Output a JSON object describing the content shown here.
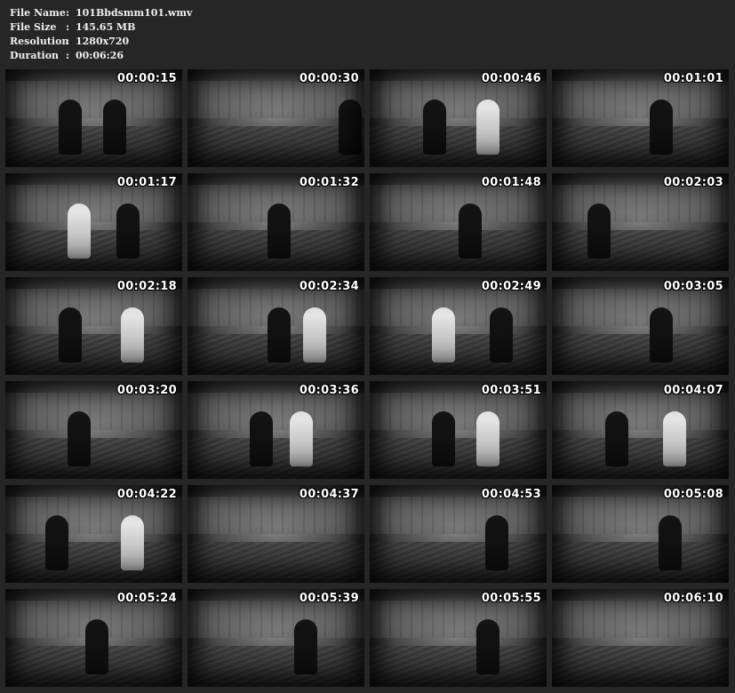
{
  "file_info": {
    "file_name": {
      "label": "File Name",
      "value": "101Bbdsmm101.wmv"
    },
    "file_size": {
      "label": "File Size",
      "value": "145.65 MB"
    },
    "resolution": {
      "label": "Resolution",
      "value": "1280x720"
    },
    "duration": {
      "label": "Duration",
      "value": "00:06:26"
    },
    "separator": ":"
  },
  "thumbnails": [
    {
      "timestamp": "00:00:15"
    },
    {
      "timestamp": "00:00:30"
    },
    {
      "timestamp": "00:00:46"
    },
    {
      "timestamp": "00:01:01"
    },
    {
      "timestamp": "00:01:17"
    },
    {
      "timestamp": "00:01:32"
    },
    {
      "timestamp": "00:01:48"
    },
    {
      "timestamp": "00:02:03"
    },
    {
      "timestamp": "00:02:18"
    },
    {
      "timestamp": "00:02:34"
    },
    {
      "timestamp": "00:02:49"
    },
    {
      "timestamp": "00:03:05"
    },
    {
      "timestamp": "00:03:20"
    },
    {
      "timestamp": "00:03:36"
    },
    {
      "timestamp": "00:03:51"
    },
    {
      "timestamp": "00:04:07"
    },
    {
      "timestamp": "00:04:22"
    },
    {
      "timestamp": "00:04:37"
    },
    {
      "timestamp": "00:04:53"
    },
    {
      "timestamp": "00:05:08"
    },
    {
      "timestamp": "00:05:24"
    },
    {
      "timestamp": "00:05:39"
    },
    {
      "timestamp": "00:05:55"
    },
    {
      "timestamp": "00:06:10"
    }
  ]
}
